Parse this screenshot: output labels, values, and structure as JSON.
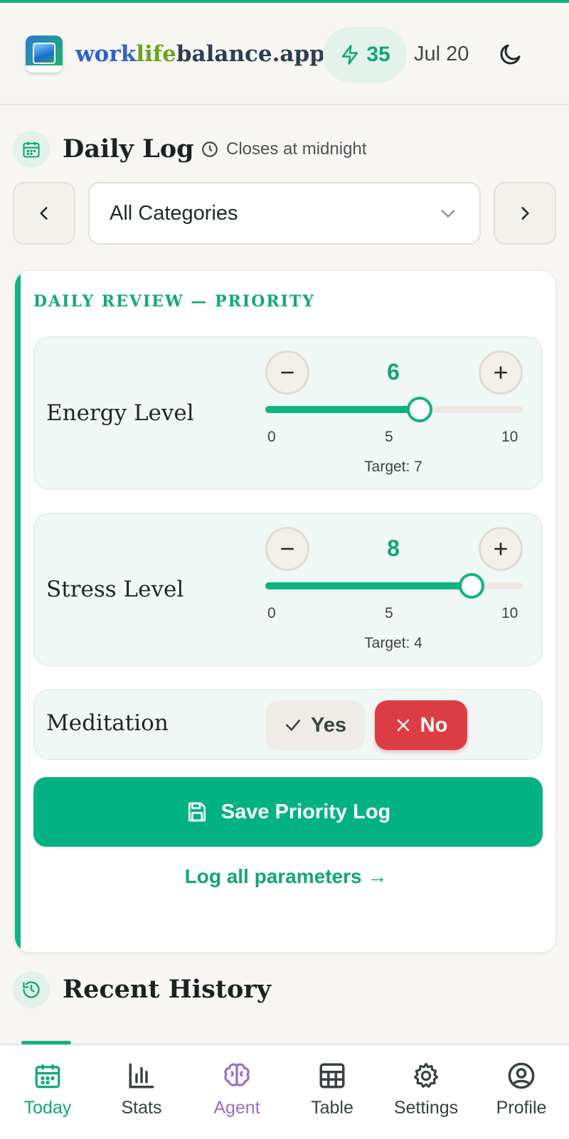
{
  "header": {
    "brand_part1": "work",
    "brand_part2": "life",
    "brand_part3": "balance.app",
    "streak_count": "35",
    "date": "Jul 20",
    "icons": [
      "app-logo",
      "bolt-icon",
      "moon-icon"
    ]
  },
  "daily_log": {
    "title": "Daily Log",
    "closes_text": "Closes at midnight",
    "category_select": "All Categories"
  },
  "card": {
    "title": "DAILY REVIEW — PRIORITY",
    "energy": {
      "label": "Energy Level",
      "value": "6",
      "value_num": 6,
      "min": "0",
      "mid": "5",
      "max": "10",
      "target": "Target: 7"
    },
    "stress": {
      "label": "Stress Level",
      "value": "8",
      "value_num": 8,
      "min": "0",
      "mid": "5",
      "max": "10",
      "target": "Target: 4"
    },
    "meditation": {
      "label": "Meditation",
      "yes_label": "Yes",
      "no_label": "No",
      "selected": "No"
    },
    "save_label": "Save Priority Log",
    "log_all_label": "Log all parameters →"
  },
  "recent_history": {
    "title": "Recent History"
  },
  "bottom_nav": {
    "items": [
      {
        "label": "Today",
        "active": true
      },
      {
        "label": "Stats"
      },
      {
        "label": "Agent"
      },
      {
        "label": "Table"
      },
      {
        "label": "Settings"
      },
      {
        "label": "Profile"
      }
    ]
  },
  "colors": {
    "accent": "#0fb382",
    "danger": "#dc3d44",
    "agent": "#9a6fc5"
  }
}
